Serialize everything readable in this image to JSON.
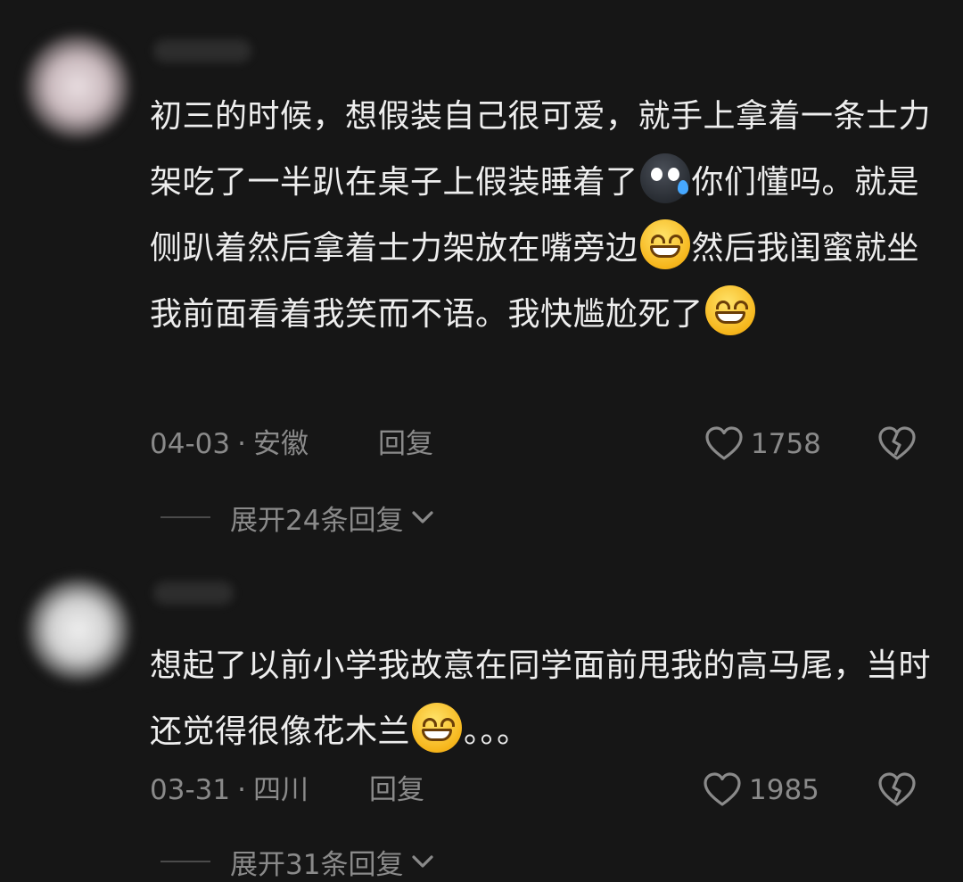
{
  "comments": [
    {
      "text_parts": [
        {
          "t": "text",
          "v": "初三的时候，想假装自己很可爱，就手上拿着一条士力架吃了一半趴在桌子上假装睡着了"
        },
        {
          "t": "emoji",
          "v": "sweat-emoji"
        },
        {
          "t": "text",
          "v": "你们懂吗。就是侧趴着然后拿着士力架放在嘴旁边"
        },
        {
          "t": "emoji",
          "v": "grin-emoji"
        },
        {
          "t": "text",
          "v": "然后我闺蜜就坐我前面看着我笑而不语。我快尴尬死了"
        },
        {
          "t": "emoji",
          "v": "grin-emoji"
        }
      ],
      "date": "04-03",
      "location": "安徽",
      "separator": "·",
      "reply_label": "回复",
      "likes": "1758",
      "expand_label": "展开24条回复"
    },
    {
      "text_parts": [
        {
          "t": "text",
          "v": "想起了以前小学我故意在同学面前甩我的高马尾，当时还觉得很像花木兰"
        },
        {
          "t": "emoji",
          "v": "grin-emoji"
        },
        {
          "t": "text",
          "v": "。。。"
        }
      ],
      "date": "03-31",
      "location": "四川",
      "separator": "·",
      "reply_label": "回复",
      "likes": "1985",
      "expand_label": "展开31条回复"
    }
  ],
  "colors": {
    "background": "#161616",
    "text": "#eeeeee",
    "meta": "#8a8a8a"
  }
}
